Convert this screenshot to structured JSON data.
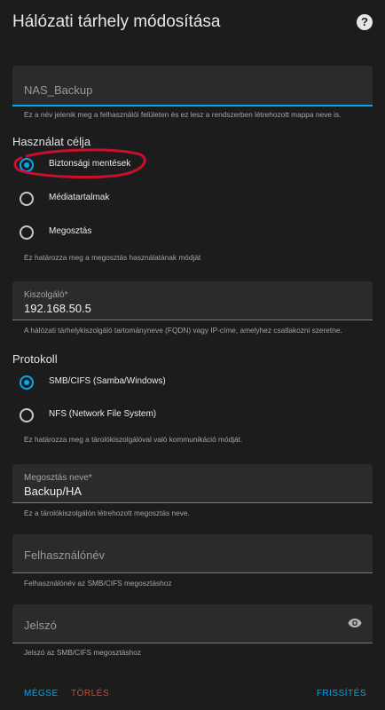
{
  "dialog": {
    "title": "Hálózati tárhely módosítása",
    "help_symbol": "?"
  },
  "name_field": {
    "placeholder": "NAS_Backup",
    "helper": "Ez a név jelenik meg a felhasználói felületen és ez lesz a rendszerben létrehozott mappa neve is."
  },
  "usage": {
    "heading": "Használat célja",
    "options": [
      {
        "label": "Biztonsági mentések",
        "checked": true
      },
      {
        "label": "Médiatartalmak",
        "checked": false
      },
      {
        "label": "Megosztás",
        "checked": false
      }
    ],
    "helper": "Ez határozza meg a megosztás használatának módját"
  },
  "server_field": {
    "label": "Kiszolgáló*",
    "value": "192.168.50.5",
    "helper": "A hálózati tárhelykiszolgáló tartományneve (FQDN) vagy IP-címe, amelyhez csatlakozni szeretne."
  },
  "protocol": {
    "heading": "Protokoll",
    "options": [
      {
        "label": "SMB/CIFS (Samba/Windows)",
        "checked": true
      },
      {
        "label": "NFS (Network File System)",
        "checked": false
      }
    ],
    "helper": "Ez határozza meg a tárolókiszolgálóval való kommunikáció módját."
  },
  "share_field": {
    "label": "Megosztás neve*",
    "value": "Backup/HA",
    "helper": "Ez a tárolókiszolgálón létrehozott megosztás neve."
  },
  "username_field": {
    "placeholder": "Felhasználónév",
    "helper": "Felhasználónév az SMB/CIFS megosztáshoz"
  },
  "password_field": {
    "placeholder": "Jelszó",
    "helper": "Jelszó az SMB/CIFS megosztáshoz",
    "icon": "eye-icon"
  },
  "actions": {
    "cancel": "MÉGSE",
    "delete": "TÖRLÉS",
    "update": "FRISSÍTÉS"
  },
  "colors": {
    "accent": "#03a9f4",
    "danger": "#db4437",
    "annotation": "#c8102e",
    "background": "#1c1c1c",
    "field": "#2b2b2b"
  }
}
